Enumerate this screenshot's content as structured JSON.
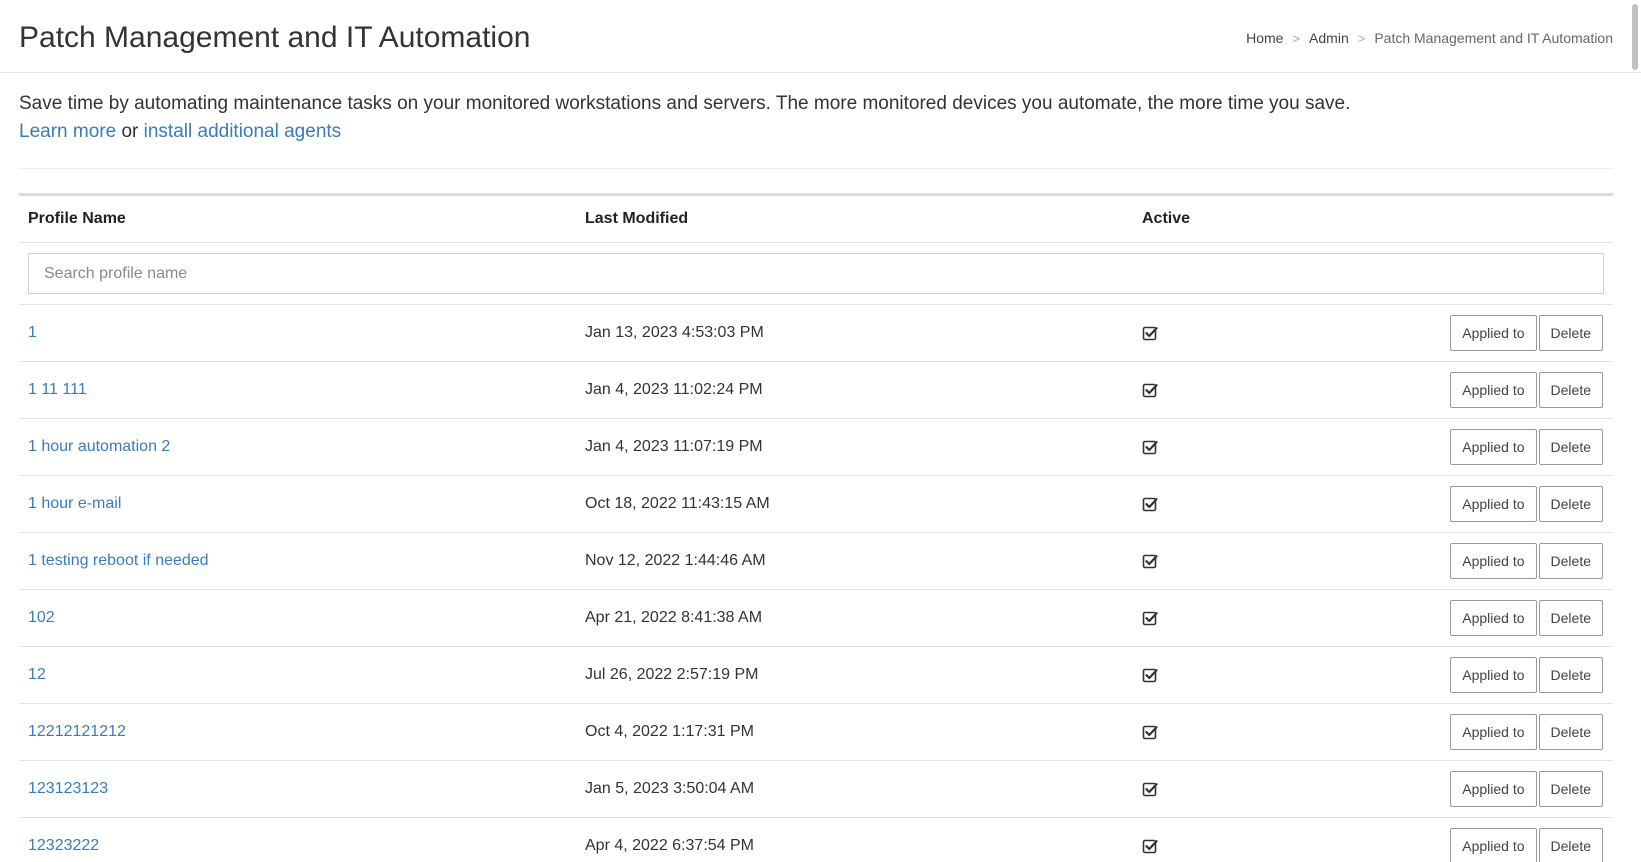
{
  "header": {
    "title": "Patch Management and IT Automation",
    "breadcrumb": [
      {
        "label": "Home"
      },
      {
        "label": "Admin"
      },
      {
        "label": "Patch Management and IT Automation"
      }
    ],
    "separator": ">"
  },
  "intro": {
    "text": "Save time by automating maintenance tasks on your monitored workstations and servers. The more monitored devices you automate, the more time you save.",
    "learn_more": "Learn more",
    "or_text": "or",
    "install_agents": "install additional agents"
  },
  "table": {
    "columns": {
      "profile_name": "Profile Name",
      "last_modified": "Last Modified",
      "active": "Active"
    },
    "search_placeholder": "Search profile name",
    "applied_label": "Applied to",
    "delete_label": "Delete",
    "rows": [
      {
        "name": "1",
        "modified": "Jan 13, 2023 4:53:03 PM",
        "active": true
      },
      {
        "name": "1 11 111",
        "modified": "Jan 4, 2023 11:02:24 PM",
        "active": true
      },
      {
        "name": "1 hour automation 2",
        "modified": "Jan 4, 2023 11:07:19 PM",
        "active": true
      },
      {
        "name": "1 hour e-mail",
        "modified": "Oct 18, 2022 11:43:15 AM",
        "active": true
      },
      {
        "name": "1 testing reboot if needed",
        "modified": "Nov 12, 2022 1:44:46 AM",
        "active": true
      },
      {
        "name": "102",
        "modified": "Apr 21, 2022 8:41:38 AM",
        "active": true
      },
      {
        "name": "12",
        "modified": "Jul 26, 2022 2:57:19 PM",
        "active": true
      },
      {
        "name": "12212121212",
        "modified": "Oct 4, 2022 1:17:31 PM",
        "active": true
      },
      {
        "name": "123123123",
        "modified": "Jan 5, 2023 3:50:04 AM",
        "active": true
      },
      {
        "name": "12323222",
        "modified": "Apr 4, 2022 6:37:54 PM",
        "active": true
      }
    ]
  },
  "colors": {
    "link": "#3a7bbf",
    "text": "#333333",
    "border": "#e3e3e3"
  }
}
